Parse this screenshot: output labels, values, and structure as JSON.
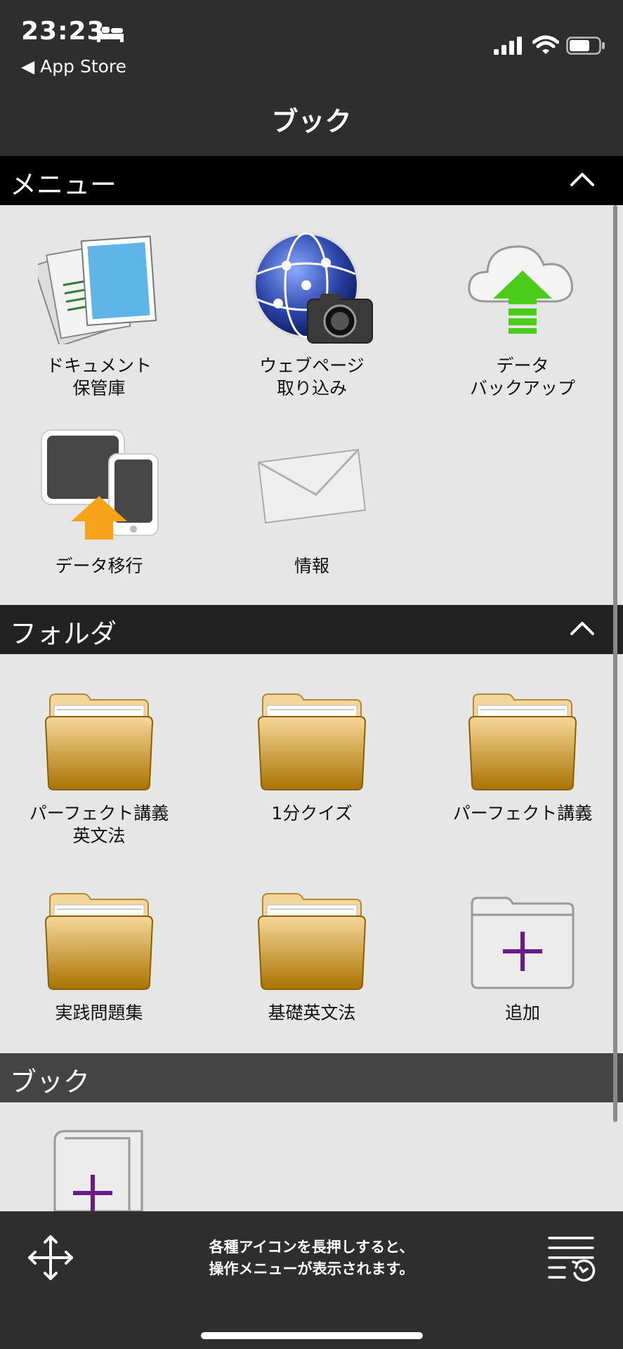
{
  "status": {
    "time": "23:23",
    "back": "◀ App Store"
  },
  "nav": {
    "title": "ブック"
  },
  "sections": {
    "menu": "メニュー",
    "folder": "フォルダ",
    "book": "ブック"
  },
  "menu_items": {
    "documents": [
      "ドキュメント",
      "保管庫"
    ],
    "webpage": [
      "ウェブページ",
      "取り込み"
    ],
    "backup": [
      "データ",
      "バックアップ"
    ],
    "migrate": [
      "データ移行"
    ],
    "info": [
      "情報"
    ]
  },
  "folders": {
    "f1": [
      "パーフェクト講義",
      "英文法"
    ],
    "f2": [
      "1分クイズ"
    ],
    "f3": [
      "パーフェクト講義"
    ],
    "f4": [
      "実践問題集"
    ],
    "f5": [
      "基礎英文法"
    ],
    "add": [
      "追加"
    ]
  },
  "toolbar": {
    "hint1": "各種アイコンを長押しすると、",
    "hint2": "操作メニューが表示されます。"
  },
  "colors": {
    "accent": "#6a1b8a",
    "header": "#000000"
  }
}
